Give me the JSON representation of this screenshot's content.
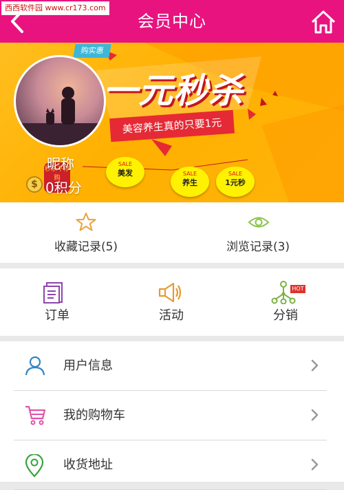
{
  "watermark": "西西软件园 www.cr173.com",
  "header": {
    "title": "会员中心"
  },
  "banner": {
    "tag": "购实惠",
    "headline": "一元秒杀",
    "slogan": "美容养生真的只要1元",
    "bag_text": "秒杀不停购",
    "sale_badges": [
      {
        "top": "SALE",
        "text": "美发"
      },
      {
        "top": "SALE",
        "text": "养生"
      },
      {
        "top": "SALE",
        "text": "1元秒"
      }
    ]
  },
  "profile": {
    "nickname": "昵称",
    "points_label": "0积分",
    "coin_symbol": "$"
  },
  "records": {
    "favorites": "收藏记录(5)",
    "history": "浏览记录(3)"
  },
  "shortcuts": {
    "orders": "订单",
    "activities": "活动",
    "distribution": "分销",
    "hot_badge": "HOT"
  },
  "menu": [
    {
      "label": "用户信息"
    },
    {
      "label": "我的购物车"
    },
    {
      "label": "收货地址"
    }
  ],
  "colors": {
    "header": "#e8137f",
    "banner": "#ffb400",
    "list_icon_blue": "#2f86c2",
    "cart_pink": "#e052a9",
    "location_green": "#35a33b"
  }
}
